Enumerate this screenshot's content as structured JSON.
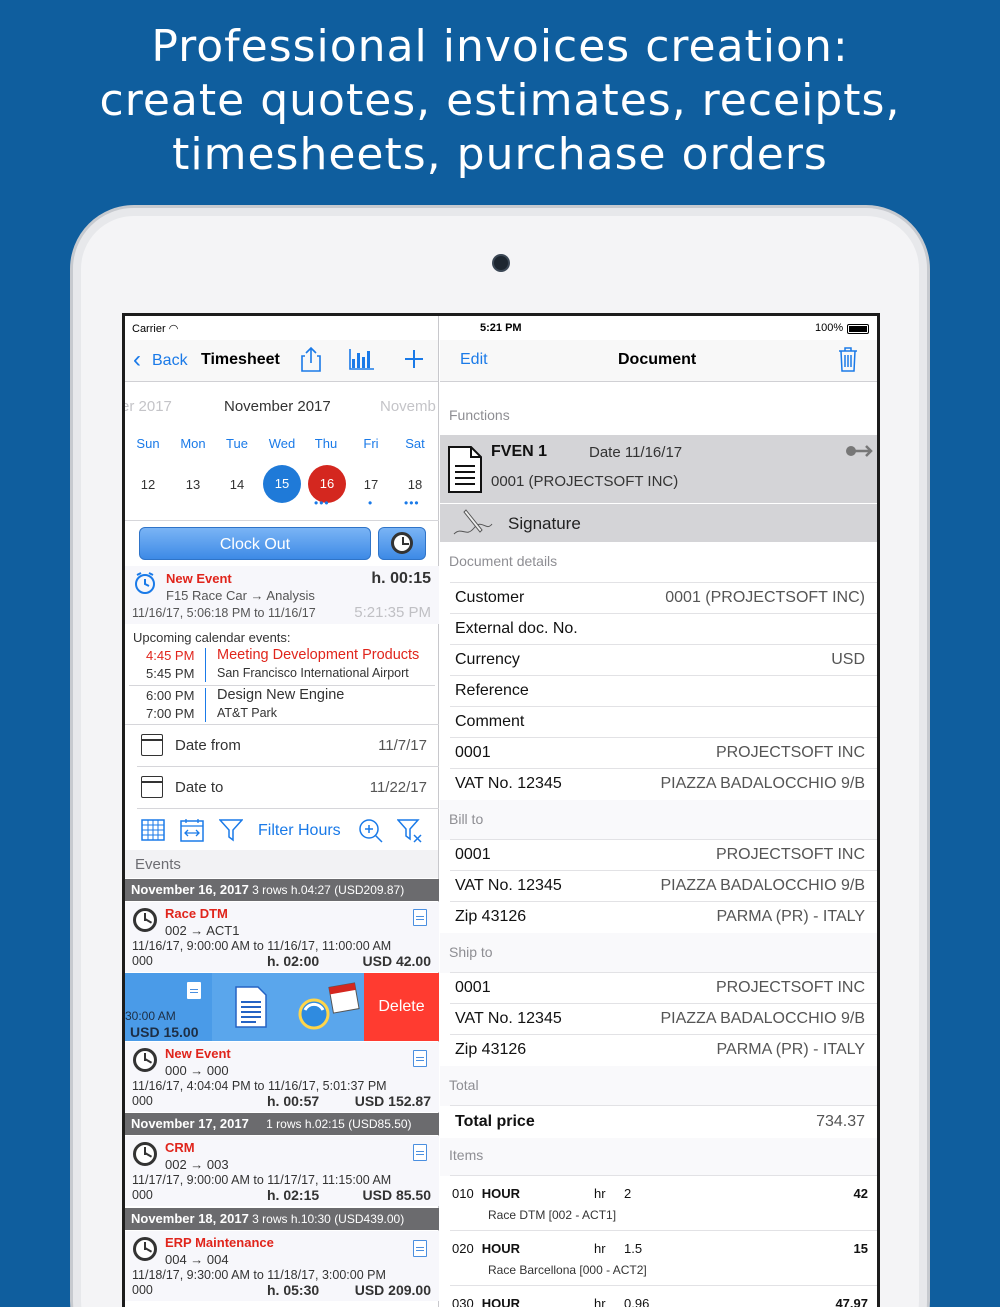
{
  "headline": {
    "line1": "Professional invoices creation:",
    "line2": "create quotes, estimates, receipts,",
    "line3": "timesheets, purchase orders"
  },
  "status_bar": {
    "carrier": "Carrier",
    "time": "5:21 PM",
    "battery": "100%"
  },
  "left": {
    "nav": {
      "back_label": "Back",
      "title": "Timesheet"
    },
    "calendar": {
      "prev_month": "er 2017",
      "month": "November 2017",
      "next_month": "Novemb",
      "day_names": [
        "Sun",
        "Mon",
        "Tue",
        "Wed",
        "Thu",
        "Fri",
        "Sat"
      ],
      "day_numbers": [
        "12",
        "13",
        "14",
        "15",
        "16",
        "17",
        "18"
      ],
      "today_color": "#1f7ad8",
      "selected_color": "#d4271f"
    },
    "clock_out_label": "Clock Out",
    "current_event": {
      "title": "New Event",
      "duration": "h. 00:15",
      "path": "F15 Race Car → Analysis",
      "range": "11/16/17, 5:06:18 PM to 11/16/17",
      "live_time": "5:21:35 PM"
    },
    "upcoming": {
      "label": "Upcoming calendar events:",
      "items": [
        {
          "start": "4:45 PM",
          "end": "5:45 PM",
          "title": "Meeting Development Products",
          "location": "San Francisco International Airport"
        },
        {
          "start": "6:00 PM",
          "end": "7:00 PM",
          "title": "Design New Engine",
          "location": "AT&T Park"
        }
      ]
    },
    "date_from": {
      "label": "Date from",
      "value": "11/7/17"
    },
    "date_to": {
      "label": "Date to",
      "value": "11/22/17"
    },
    "filter_label": "Filter Hours",
    "events_header": "Events",
    "groups": [
      {
        "date": "November 16, 2017",
        "summary": "3 rows h.04:27 (USD209.87)"
      },
      {
        "date": "November 17, 2017",
        "summary": "1 rows h.02:15 (USD85.50)"
      },
      {
        "date": "November 18, 2017",
        "summary": "3 rows h.10:30 (USD439.00)"
      }
    ],
    "events": [
      {
        "title": "Race DTM",
        "sub": "002 → ACT1",
        "range": "11/16/17, 9:00:00 AM to 11/16/17, 11:00:00 AM",
        "code": "000",
        "hours": "h. 02:00",
        "amount": "USD 42.00"
      },
      {
        "title": "New Event",
        "sub": "000 → 000",
        "range": "11/16/17, 4:04:04 PM to 11/16/17, 5:01:37 PM",
        "code": "000",
        "hours": "h. 00:57",
        "amount": "USD 152.87"
      },
      {
        "title": "CRM",
        "sub": "002 → 003",
        "range": "11/17/17, 9:00:00 AM to 11/17/17, 11:15:00 AM",
        "code": "000",
        "hours": "h. 02:15",
        "amount": "USD 85.50"
      },
      {
        "title": "ERP Maintenance",
        "sub": "004 → 004",
        "range": "11/18/17, 9:30:00 AM to 11/18/17, 3:00:00 PM",
        "code": "000",
        "hours": "h. 05:30",
        "amount": "USD 209.00"
      }
    ],
    "swiped_row": {
      "time_fragment": "30:00 AM",
      "amount_fragment": "USD 15.00",
      "delete_label": "Delete"
    }
  },
  "right": {
    "nav": {
      "edit_label": "Edit",
      "title": "Document"
    },
    "functions_header": "Functions",
    "document": {
      "number": "FVEN 1",
      "date": "Date 11/16/17",
      "customer": "0001 (PROJECTSOFT INC)"
    },
    "signature_label": "Signature",
    "details_header": "Document details",
    "details": [
      {
        "label": "Customer",
        "value": "0001 (PROJECTSOFT INC)"
      },
      {
        "label": "External doc. No.",
        "value": ""
      },
      {
        "label": "Currency",
        "value": "USD"
      },
      {
        "label": "Reference",
        "value": ""
      },
      {
        "label": "Comment",
        "value": ""
      },
      {
        "label": "0001",
        "value": "PROJECTSOFT INC"
      },
      {
        "label": "VAT No. 12345",
        "value": "PIAZZA BADALOCCHIO 9/B"
      }
    ],
    "bill_to_header": "Bill to",
    "bill_to": [
      {
        "label": "0001",
        "value": "PROJECTSOFT INC"
      },
      {
        "label": "VAT No. 12345",
        "value": "PIAZZA BADALOCCHIO 9/B"
      },
      {
        "label": "Zip 43126",
        "value": "PARMA (PR) - ITALY"
      }
    ],
    "ship_to_header": "Ship to",
    "ship_to": [
      {
        "label": "0001",
        "value": "PROJECTSOFT INC"
      },
      {
        "label": "VAT No. 12345",
        "value": "PIAZZA BADALOCCHIO 9/B"
      },
      {
        "label": "Zip 43126",
        "value": "PARMA (PR) - ITALY"
      }
    ],
    "total_header": "Total",
    "total": {
      "label": "Total price",
      "value": "734.37"
    },
    "items_header": "Items",
    "items": [
      {
        "line": "010",
        "code": "HOUR",
        "unit": "hr",
        "qty": "2",
        "total": "42",
        "desc": "Race DTM [002 - ACT1]"
      },
      {
        "line": "020",
        "code": "HOUR",
        "unit": "hr",
        "qty": "1.5",
        "total": "15",
        "desc": "Race Barcellona [000 - ACT2]"
      },
      {
        "line": "030",
        "code": "HOUR",
        "unit": "hr",
        "qty": "0.96",
        "total": "47.97",
        "desc": ""
      }
    ]
  },
  "colors": {
    "background": "#0f5e9e",
    "accent_blue": "#1a7ae8",
    "event_red": "#e0251c",
    "delete_red": "#ff3b30",
    "swipe_blue": "#4a9be8"
  }
}
